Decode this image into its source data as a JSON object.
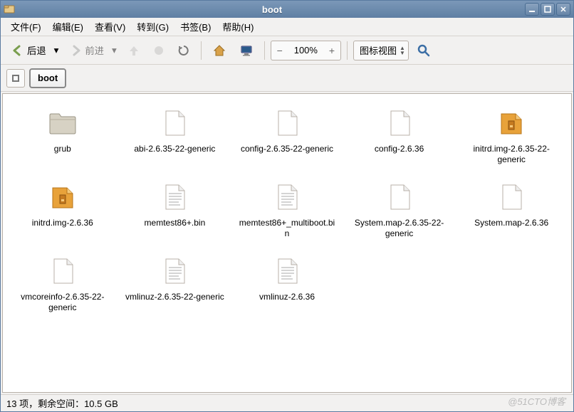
{
  "window": {
    "title": "boot"
  },
  "menubar": {
    "file": "文件(F)",
    "edit": "编辑(E)",
    "view": "查看(V)",
    "go": "转到(G)",
    "bookmarks": "书签(B)",
    "help": "帮助(H)"
  },
  "toolbar": {
    "back_label": "后退",
    "forward_label": "前进",
    "zoom_value": "100%",
    "view_mode": "图标视图"
  },
  "location": {
    "crumb": "boot"
  },
  "files": [
    {
      "name": "grub",
      "type": "folder"
    },
    {
      "name": "abi-2.6.35-22-generic",
      "type": "file"
    },
    {
      "name": "config-2.6.35-22-generic",
      "type": "file"
    },
    {
      "name": "config-2.6.36",
      "type": "file"
    },
    {
      "name": "initrd.img-2.6.35-22-generic",
      "type": "archive"
    },
    {
      "name": "initrd.img-2.6.36",
      "type": "archive"
    },
    {
      "name": "memtest86+.bin",
      "type": "text"
    },
    {
      "name": "memtest86+_multiboot.bin",
      "type": "text"
    },
    {
      "name": "System.map-2.6.35-22-generic",
      "type": "file"
    },
    {
      "name": "System.map-2.6.36",
      "type": "file"
    },
    {
      "name": "vmcoreinfo-2.6.35-22-generic",
      "type": "file"
    },
    {
      "name": "vmlinuz-2.6.35-22-generic",
      "type": "text"
    },
    {
      "name": "vmlinuz-2.6.36",
      "type": "text"
    }
  ],
  "statusbar": {
    "text": "13 项，剩余空间：10.5 GB"
  },
  "watermark": "@51CTO博客"
}
